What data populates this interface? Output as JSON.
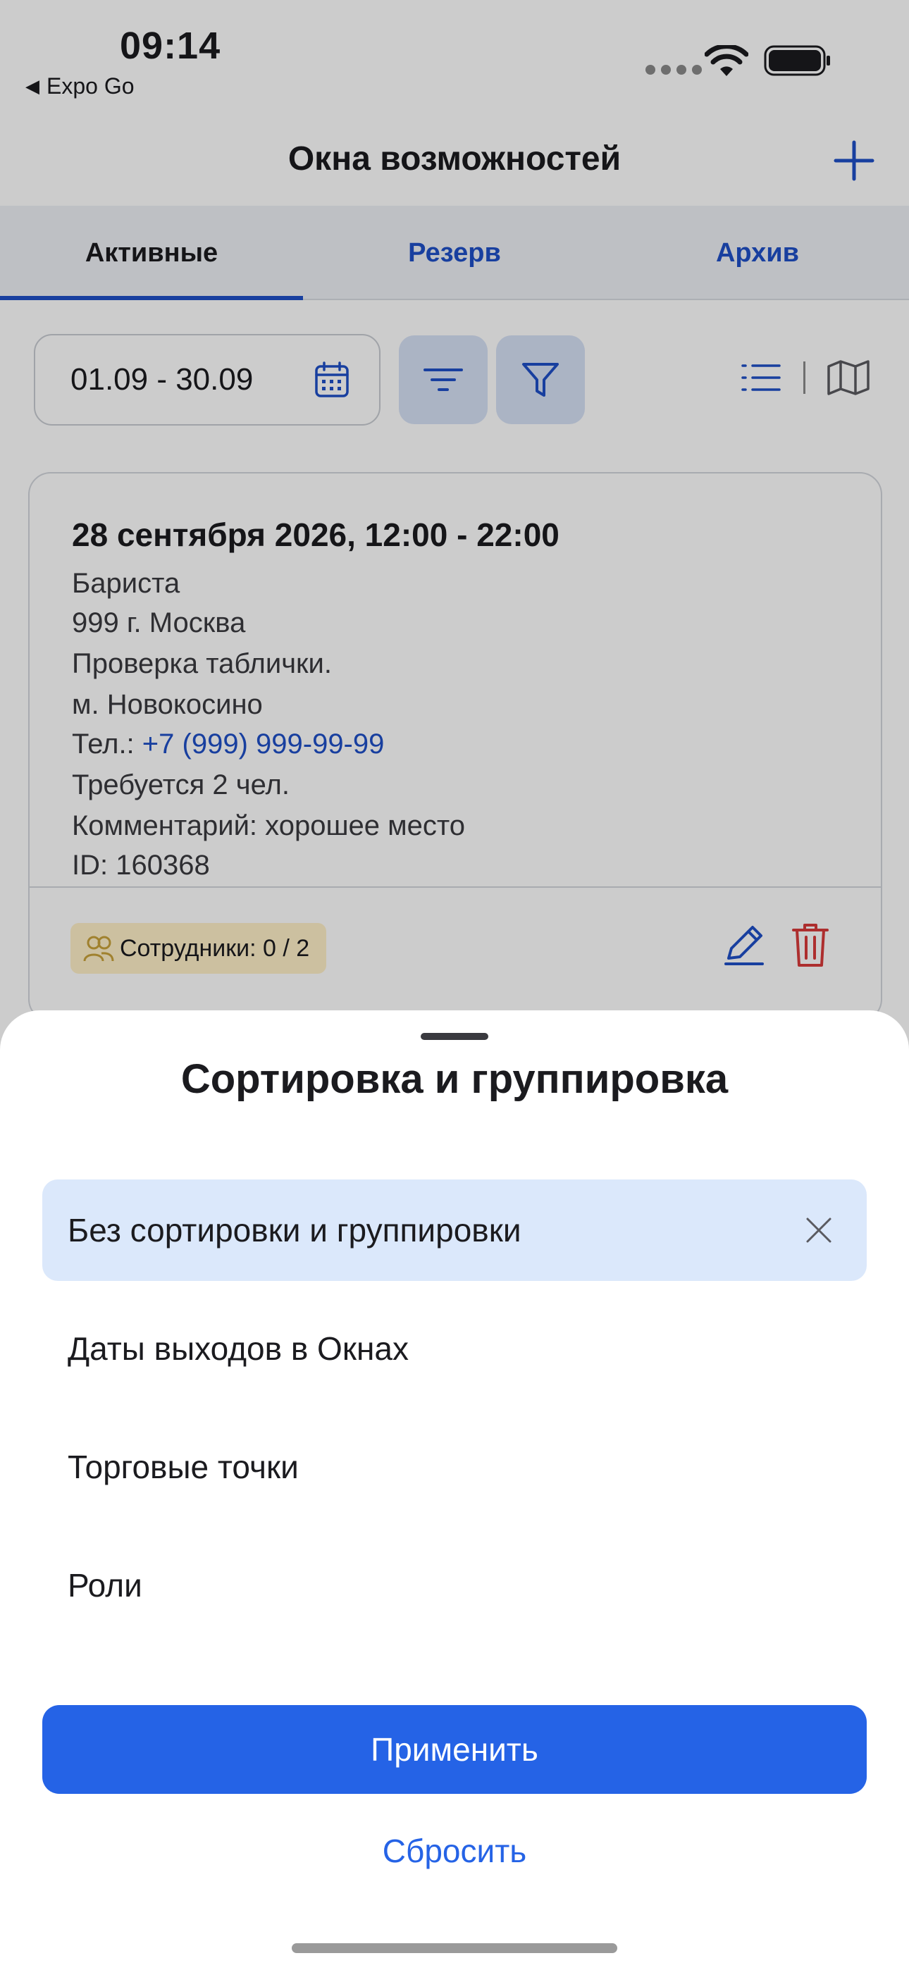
{
  "status_bar": {
    "time": "09:14",
    "back_app": "Expo Go"
  },
  "nav": {
    "title": "Окна возможностей"
  },
  "tabs": [
    {
      "label": "Активные",
      "active": true
    },
    {
      "label": "Резерв",
      "active": false
    },
    {
      "label": "Архив",
      "active": false
    }
  ],
  "filters": {
    "date_range": "01.09 - 30.09"
  },
  "card": {
    "title": "28 сентября 2026, 12:00 - 22:00",
    "role": "Бариста",
    "address": "999 г. Москва",
    "note": "Проверка таблички.",
    "metro": "м. Новокосино",
    "phone_label": "Тел.: ",
    "phone": "+7 (999) 999-99-99",
    "required": "Требуется 2 чел.",
    "comment": "Комментарий: хорошее место",
    "id": "ID: 160368",
    "employees_badge": "Сотрудники: 0 / 2"
  },
  "sheet": {
    "title": "Сортировка и группировка",
    "options": [
      {
        "label": "Без сортировки и группировки",
        "selected": true
      },
      {
        "label": "Даты выходов в Окнах",
        "selected": false
      },
      {
        "label": "Торговые точки",
        "selected": false
      },
      {
        "label": "Роли",
        "selected": false
      }
    ],
    "apply_label": "Применить",
    "reset_label": "Сбросить"
  },
  "colors": {
    "accent": "#2563e6",
    "selected_bg": "#dbe8fb",
    "danger": "#d93a3a"
  }
}
